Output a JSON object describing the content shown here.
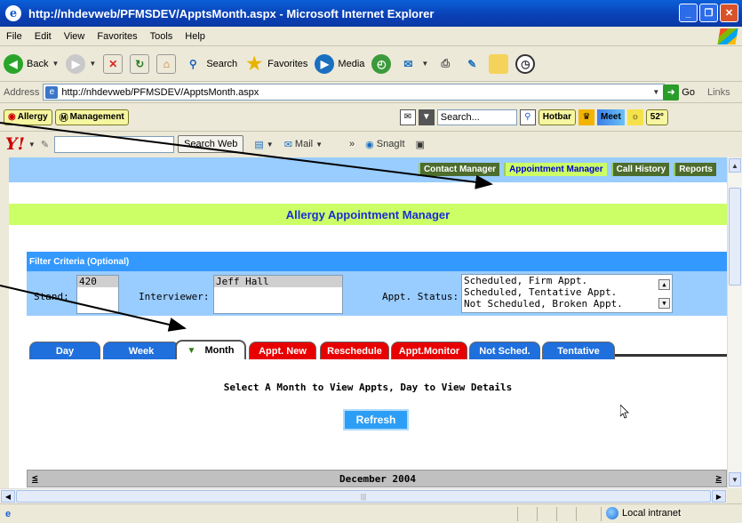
{
  "window": {
    "title": "http://nhdevweb/PFMSDEV/ApptsMonth.aspx - Microsoft Internet Explorer",
    "minimize": "_",
    "maximize": "❐",
    "close": "✕"
  },
  "menu": [
    "File",
    "Edit",
    "View",
    "Favorites",
    "Tools",
    "Help"
  ],
  "toolbar": {
    "back": "Back",
    "search": "Search",
    "favorites": "Favorites",
    "media": "Media"
  },
  "address": {
    "label": "Address",
    "url": "http://nhdevweb/PFMSDEV/ApptsMonth.aspx",
    "go": "Go",
    "links": "Links"
  },
  "linksbar": {
    "allergy": "Allergy",
    "management": "Management",
    "search_placeholder": "Search...",
    "hotbar": "Hotbar",
    "meet": "Meet",
    "temp": "52°"
  },
  "yahoo": {
    "logo": "Y!",
    "search_btn": "Search Web",
    "mail": "Mail",
    "snagit": "SnagIt",
    "more": "»"
  },
  "nav": [
    "Contact Manager",
    "Appointment Manager",
    "Call History",
    "Reports"
  ],
  "app": {
    "title": "Allergy Appointment Manager"
  },
  "filter": {
    "heading": "Filter Criteria (Optional)",
    "stand_label": "Stand:",
    "stand_value": "420",
    "interviewer_label": "Interviewer:",
    "interviewer_value": "Jeff Hall",
    "status_label": "Appt. Status:",
    "status_options": [
      "Scheduled, Firm Appt.",
      "Scheduled, Tentative Appt.",
      "Not Scheduled, Broken Appt."
    ]
  },
  "tabs": [
    "Day",
    "Week",
    "Month",
    "Appt. New",
    "Reschedule",
    "Appt.Monitor",
    "Not Sched.",
    "Tentative"
  ],
  "instruction": "Select A Month to View Appts, Day to View Details",
  "refresh": "Refresh",
  "calendar": {
    "month": "December 2004",
    "prev": "≤",
    "next": "≥"
  },
  "status": {
    "zone": "Local intranet"
  },
  "colors": {
    "nav_bg": "#99ccff",
    "header_bg": "#ccff66",
    "filter_head": "#3399ff",
    "tab_blue": "#1f6fdd",
    "tab_red": "#e80000"
  }
}
